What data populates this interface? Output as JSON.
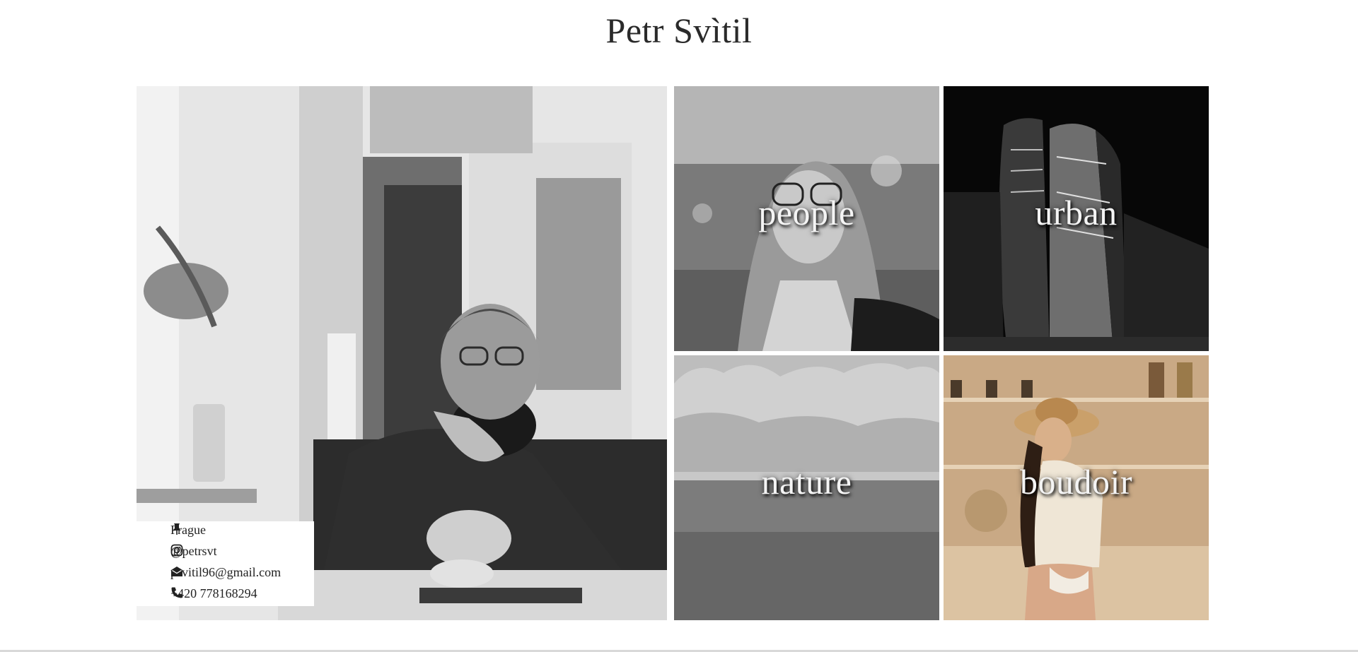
{
  "site": {
    "title": "Petr Svìtil"
  },
  "contact": {
    "location": "Prague",
    "instagram": "@petrsvt",
    "email": "psvitil96@gmail.com",
    "phone": "+420 778168294"
  },
  "categories": [
    {
      "label": "people"
    },
    {
      "label": "urban"
    },
    {
      "label": "nature"
    },
    {
      "label": "boudoir"
    }
  ],
  "icons": {
    "location": "pushpin-icon",
    "instagram": "instagram-icon",
    "email": "envelope-icon",
    "phone": "phone-icon"
  }
}
